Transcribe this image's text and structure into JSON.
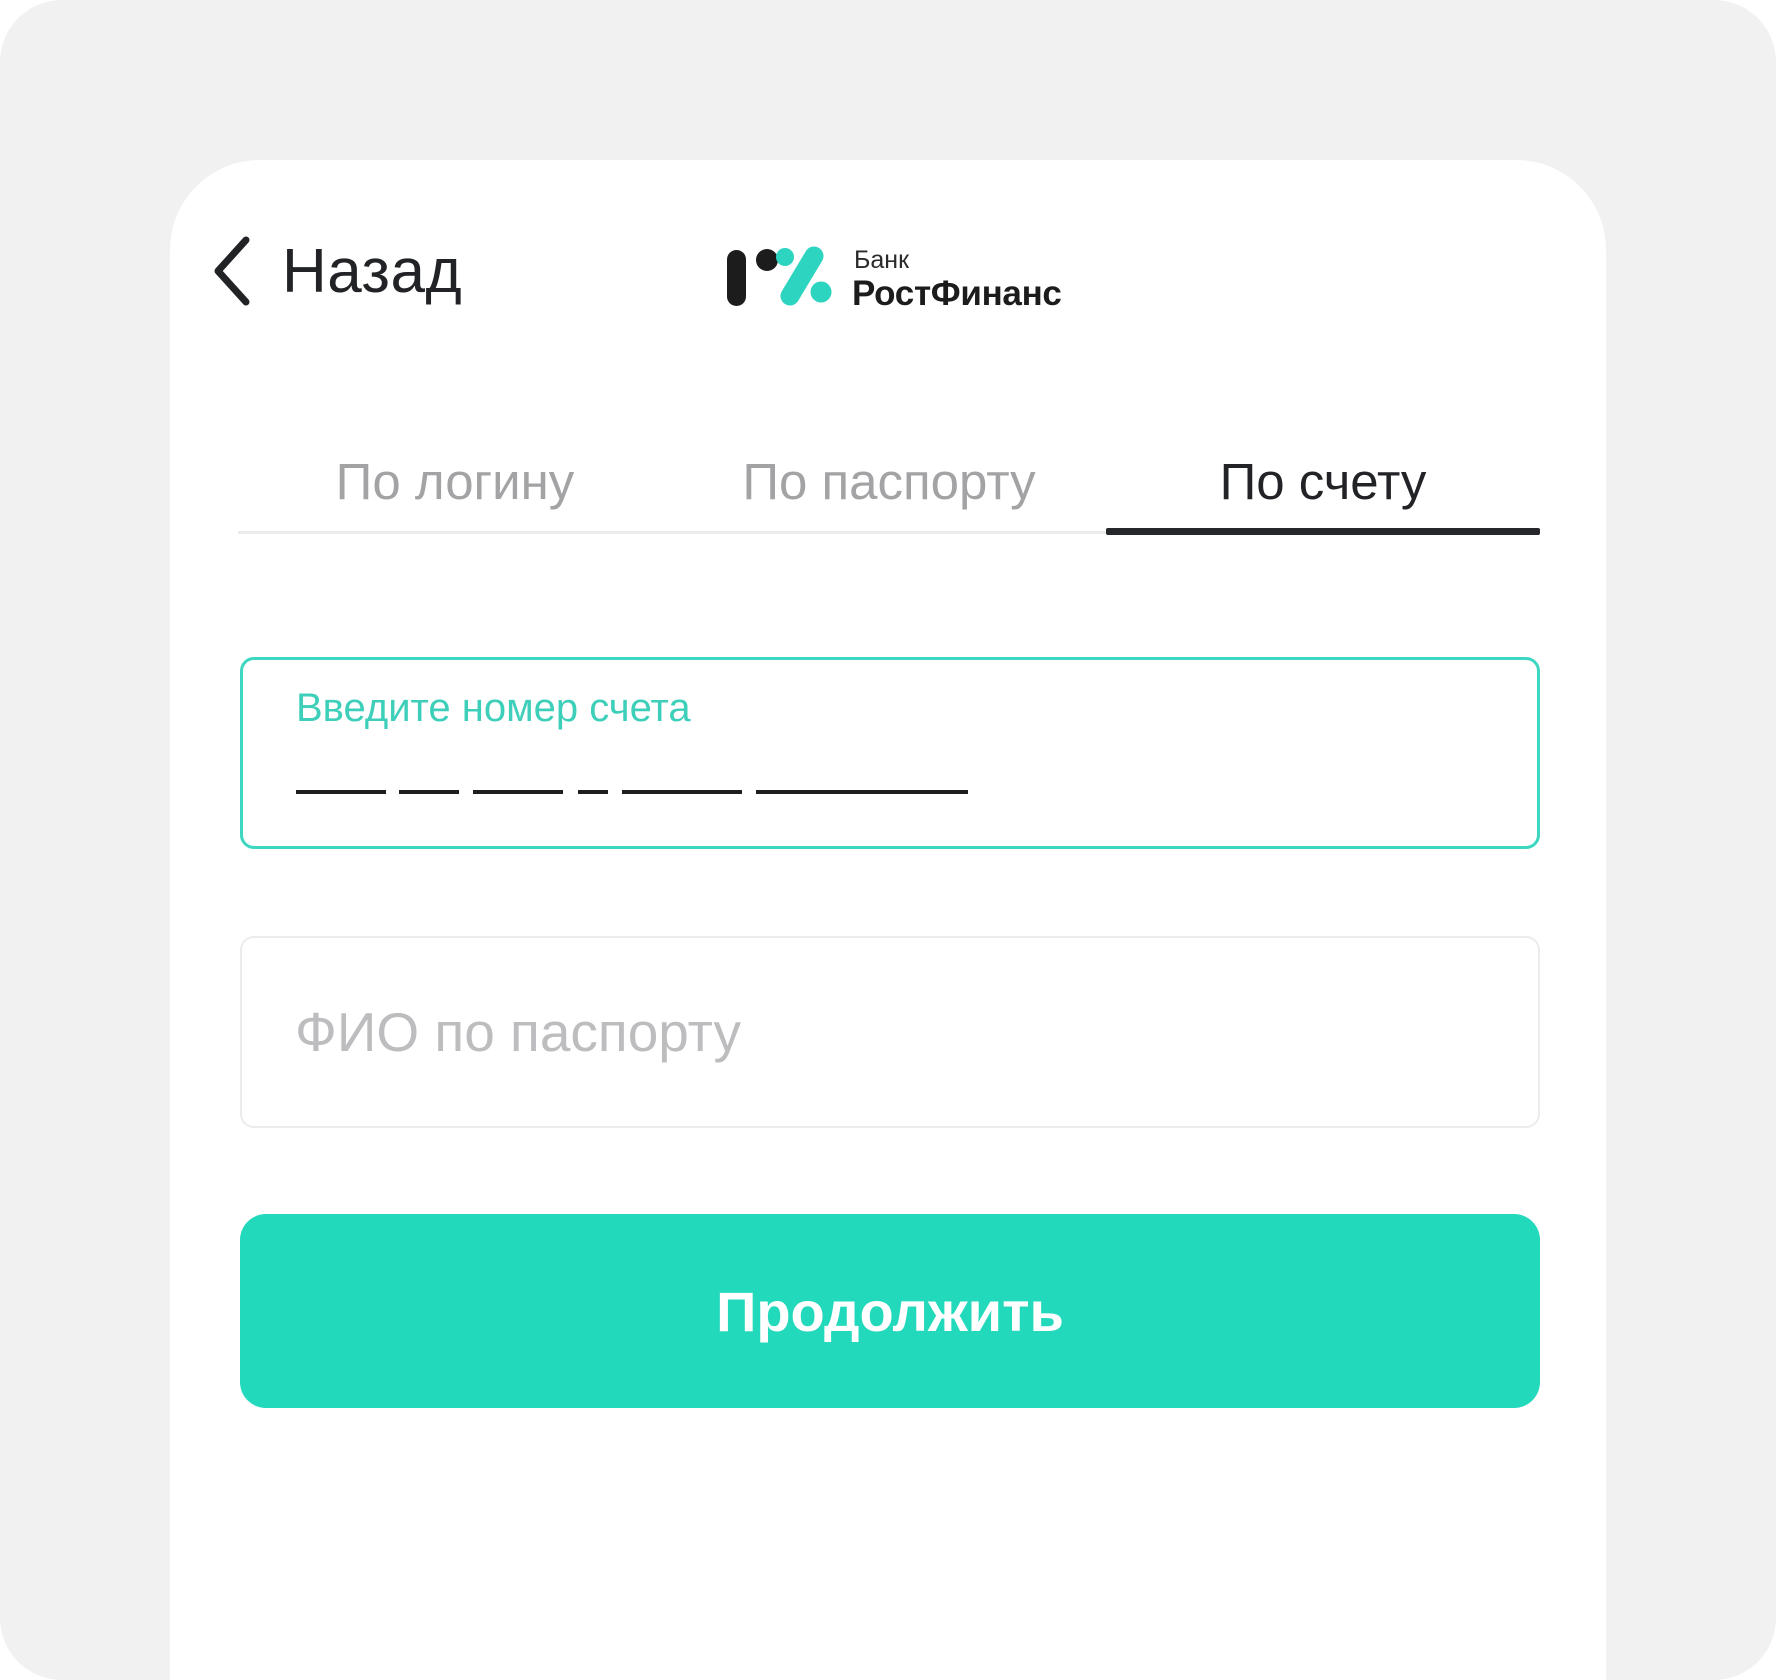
{
  "header": {
    "back_label": "Назад",
    "back_icon": "chevron-left-icon",
    "logo": {
      "small_text": "Банк",
      "big_text": "РостФинанс",
      "colors": {
        "dark": "#1c1c1c",
        "accent": "#2dd4bf"
      }
    }
  },
  "tabs": [
    {
      "label": "По логину",
      "active": false
    },
    {
      "label": "По паспорту",
      "active": false
    },
    {
      "label": "По счету",
      "active": true
    }
  ],
  "account_field": {
    "label": "Введите номер счета",
    "value": "___ __ ___ _ ____ _______",
    "state": "focused"
  },
  "fio_field": {
    "placeholder": "ФИО по паспорту",
    "value": ""
  },
  "continue_button": {
    "label": "Продолжить"
  },
  "colors": {
    "accent": "#22d9bc",
    "accent_text": "#3dcfb9",
    "background": "#f1f1f1",
    "card": "#ffffff",
    "text": "#222326",
    "muted": "#a3a3a6"
  }
}
